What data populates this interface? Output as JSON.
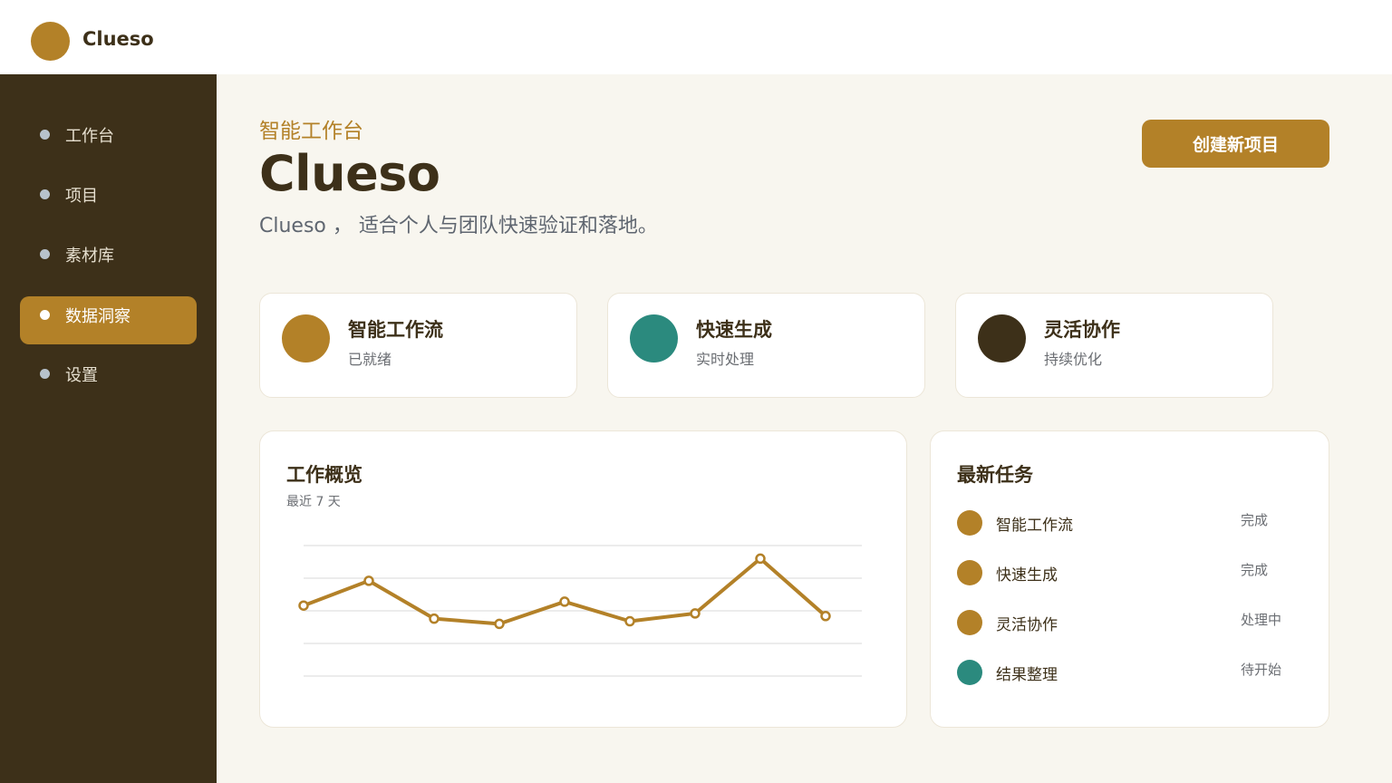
{
  "app": {
    "name": "Clueso"
  },
  "nav": {
    "items": [
      {
        "label": "工作台",
        "active": false
      },
      {
        "label": "项目",
        "active": false
      },
      {
        "label": "素材库",
        "active": false
      },
      {
        "label": "数据洞察",
        "active": true
      },
      {
        "label": "设置",
        "active": false
      }
    ]
  },
  "header": {
    "subtitle": "智能工作台",
    "title": "Clueso",
    "tagline": "Clueso ， 适合个人与团队快速验证和落地。",
    "create_button": "创建新项目"
  },
  "features": [
    {
      "title": "智能工作流",
      "sub": "已就绪",
      "color": "#b38128"
    },
    {
      "title": "快速生成",
      "sub": "实时处理",
      "color": "#2b8a7e"
    },
    {
      "title": "灵活协作",
      "sub": "持续优化",
      "color": "#3d3019"
    }
  ],
  "overview": {
    "title": "工作概览",
    "subtitle": "最近 7 天"
  },
  "chart_data": {
    "type": "line",
    "x": [
      1,
      2,
      3,
      4,
      5,
      6,
      7,
      8,
      9
    ],
    "series": [
      {
        "values": [
          54,
          73,
          44,
          40,
          57,
          42,
          48,
          90,
          46
        ],
        "color": "#b38128"
      }
    ],
    "ylim": [
      0,
      100
    ],
    "grid": true
  },
  "tasks": {
    "title": "最新任务",
    "items": [
      {
        "name": "智能工作流",
        "status": "完成",
        "color": "#b38128"
      },
      {
        "name": "快速生成",
        "status": "完成",
        "color": "#b38128"
      },
      {
        "name": "灵活协作",
        "status": "处理中",
        "color": "#b38128"
      },
      {
        "name": "结果整理",
        "status": "待开始",
        "color": "#2b8a7e"
      }
    ]
  }
}
